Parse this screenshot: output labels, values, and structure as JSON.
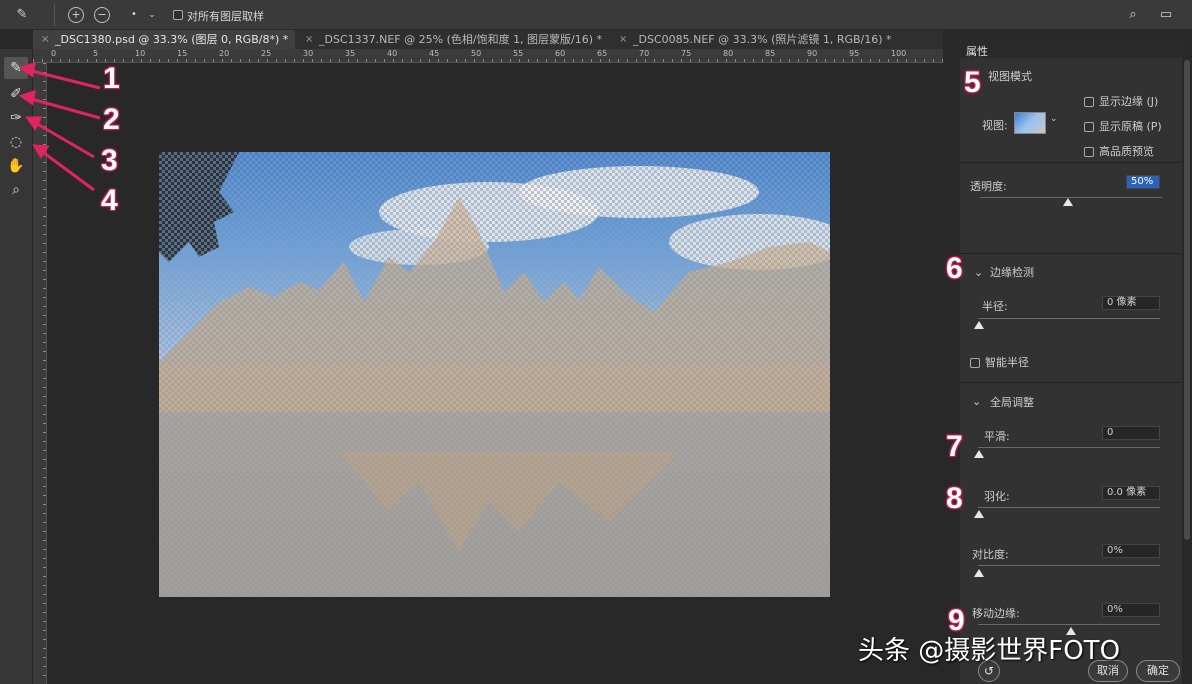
{
  "options_bar": {
    "tool_icon": "brush-icon",
    "add_icon": "plus-circle-icon",
    "subtract_icon": "minus-circle-icon",
    "brush_size_icon": "brush-size-icon",
    "sample_all_layers_label": "对所有图层取样"
  },
  "tabs": [
    {
      "label": "_DSC1380.psd @ 33.3% (图层 0, RGB/8*) *",
      "close": "×",
      "active": true
    },
    {
      "label": "_DSC1337.NEF @ 25% (色相/饱和度 1, 图层蒙版/16) *",
      "close": "×",
      "active": false
    },
    {
      "label": "_DSC0085.NEF @ 33.3% (照片滤镜 1, RGB/16) *",
      "close": "×",
      "active": false
    }
  ],
  "ruler_numbers": [
    "0",
    "5",
    "10",
    "15",
    "20",
    "25",
    "30",
    "35",
    "40",
    "45",
    "50",
    "55",
    "60",
    "65",
    "70",
    "75",
    "80",
    "85",
    "90",
    "95",
    "100"
  ],
  "tools": [
    {
      "name": "quick-selection-tool-icon",
      "glyph": "✎"
    },
    {
      "name": "refine-edge-brush-tool-icon",
      "glyph": "✐"
    },
    {
      "name": "brush-tool-icon",
      "glyph": "✑"
    },
    {
      "name": "lasso-tool-icon",
      "glyph": "◌"
    },
    {
      "name": "hand-tool-icon",
      "glyph": "✋"
    },
    {
      "name": "zoom-tool-icon",
      "glyph": "⌕"
    }
  ],
  "panel": {
    "tab_label": "属性",
    "view_mode_heading": "视图模式",
    "view_label": "视图:",
    "show_edge_label": "显示边缘 (J)",
    "show_original_label": "显示原稿 (P)",
    "hq_preview_label": "高品质预览",
    "opacity_label": "透明度:",
    "opacity_value": "50%",
    "edge_detection_heading": "边缘检测",
    "radius_label": "半径:",
    "radius_value": "0 像素",
    "smart_radius_label": "智能半径",
    "global_refine_heading": "全局调整",
    "smooth_label": "平滑:",
    "smooth_value": "0",
    "feather_label": "羽化:",
    "feather_value": "0.0 像素",
    "contrast_label": "对比度:",
    "contrast_value": "0%",
    "shift_edge_label": "移动边缘:",
    "shift_edge_value": "0%",
    "cancel_label": "取消",
    "ok_label": "确定"
  },
  "annotations": [
    "1",
    "2",
    "3",
    "4",
    "5",
    "6",
    "7",
    "8",
    "9"
  ],
  "watermark": "头条 @摄影世界FOTO",
  "colors": {
    "annotation": "#e0245e"
  }
}
